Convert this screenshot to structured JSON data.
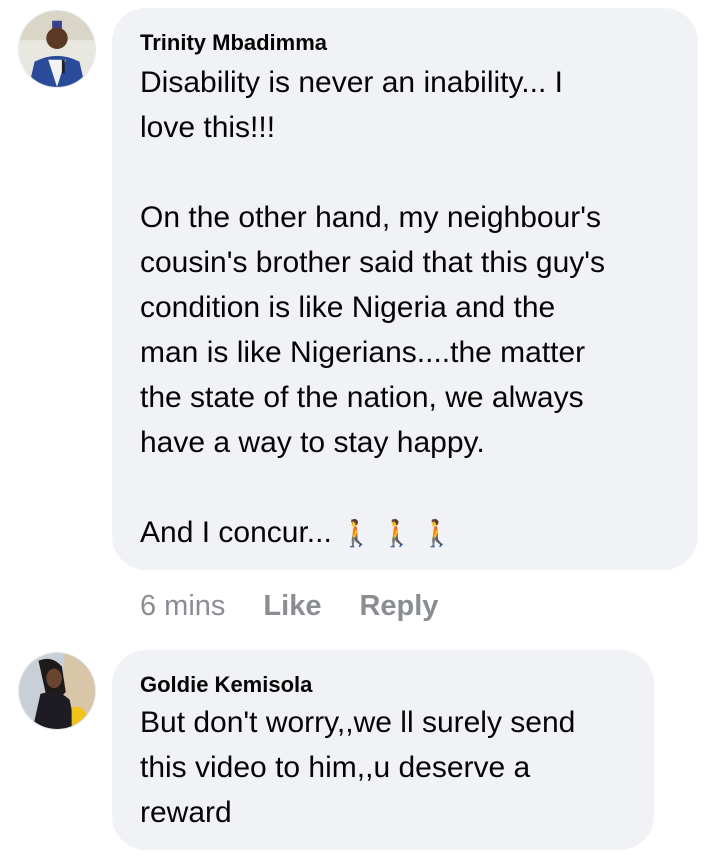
{
  "comments": [
    {
      "author": "Trinity Mbadimma",
      "text": "Disability is never an inability... I\nlove this!!!\n\nOn the other hand, my neighbour's\ncousin's brother said that this guy's\ncondition is like Nigeria and the\nman is like Nigerians....the matter\nthe state of the nation, we always\nhave a way to stay happy.\n\nAnd I concur...",
      "emoji": "🚶🚶🚶",
      "time": "6 mins",
      "like_label": "Like",
      "reply_label": "Reply"
    },
    {
      "author": "Goldie Kemisola",
      "text": "But don't worry,,we ll surely send\nthis video to him,,u deserve a\nreward"
    }
  ],
  "colors": {
    "bubble": "#f0f2f5",
    "meta_text": "#8a8d91",
    "text": "#050505"
  }
}
